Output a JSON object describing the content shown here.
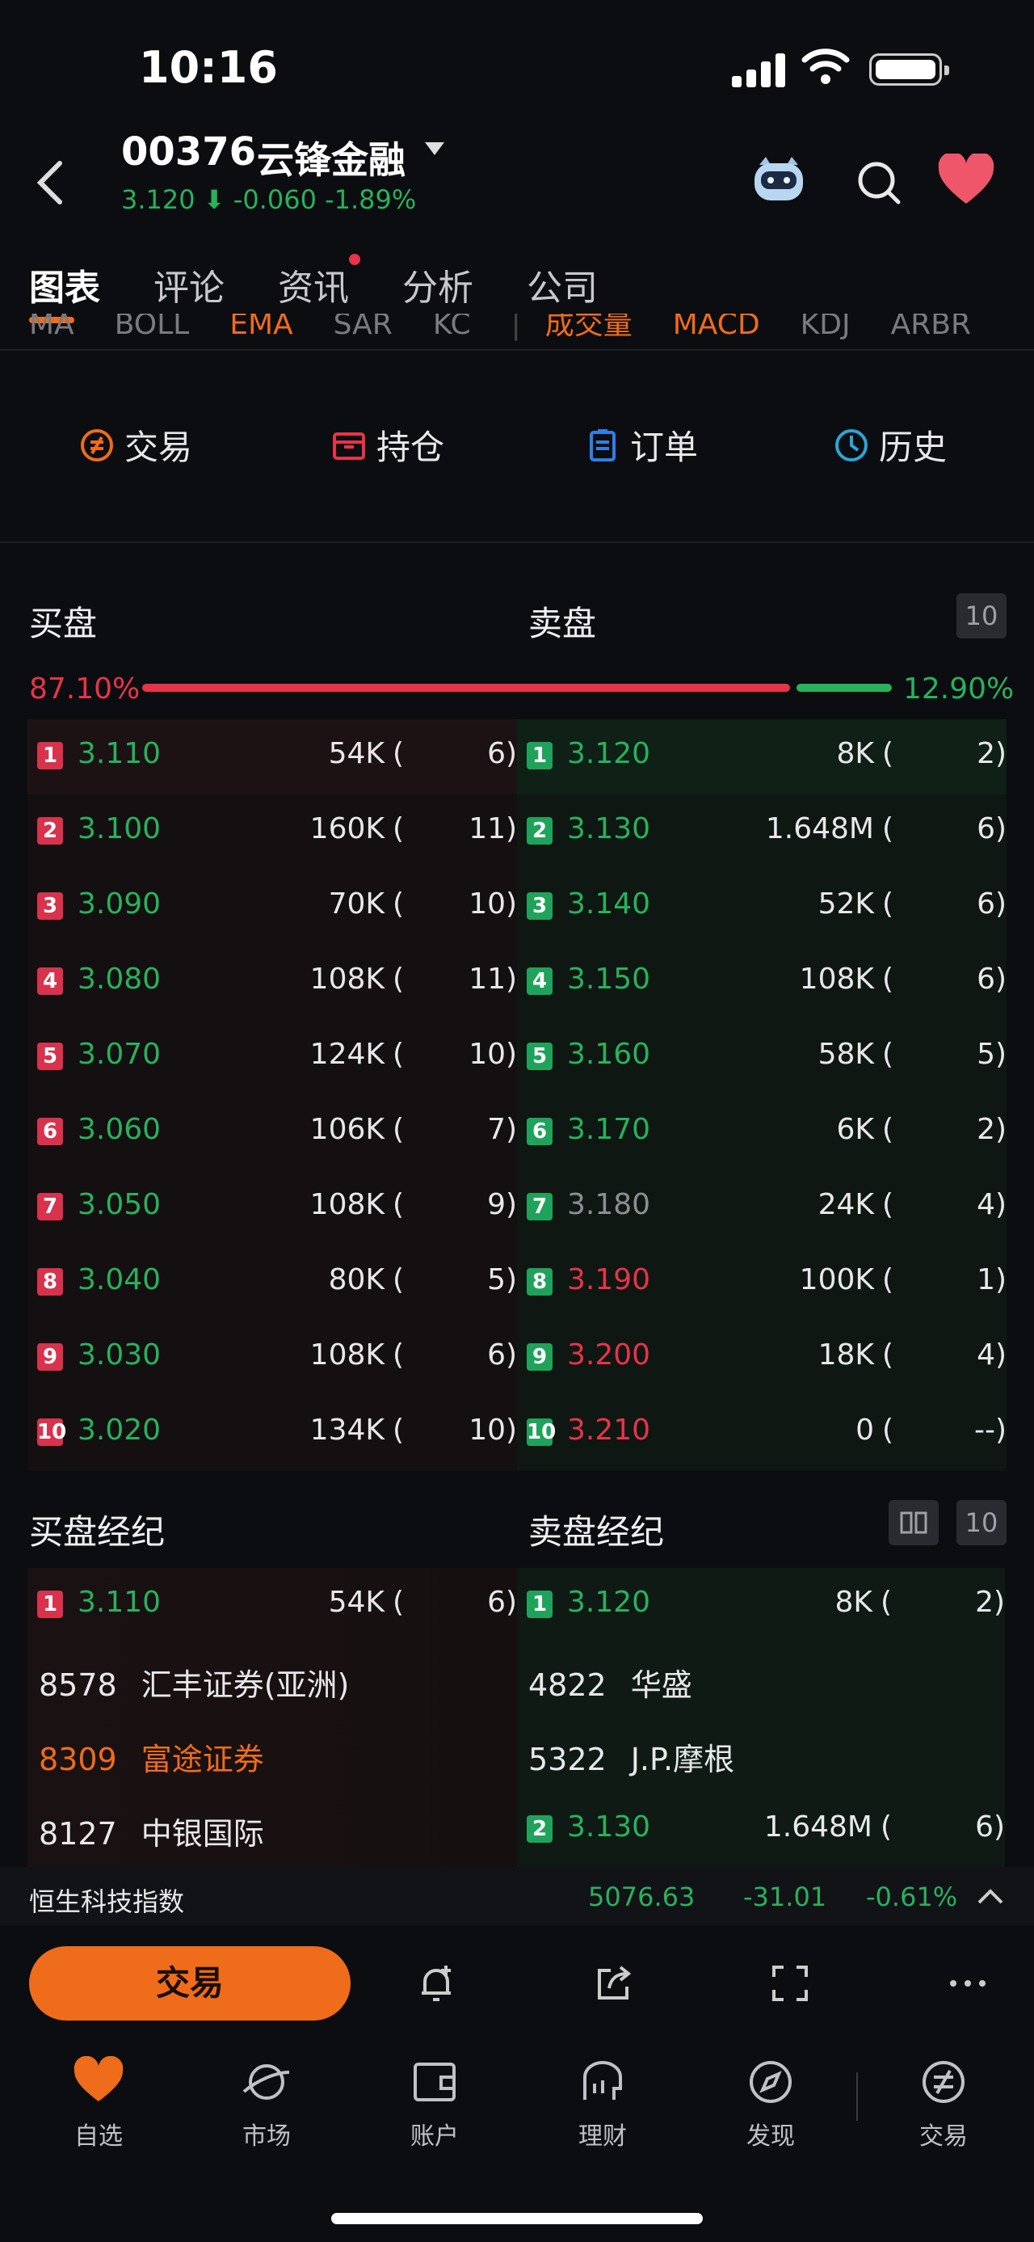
{
  "status": {
    "time": "10:16"
  },
  "header": {
    "code": "00376",
    "name": "云锋金融",
    "price": "3.120",
    "change": "-0.060",
    "change_pct": "-1.89%"
  },
  "tabs": [
    {
      "label": "图表",
      "active": true
    },
    {
      "label": "评论"
    },
    {
      "label": "资讯",
      "dot": true
    },
    {
      "label": "分析"
    },
    {
      "label": "公司"
    }
  ],
  "indicators": [
    "MA",
    "BOLL",
    "EMA",
    "SAR",
    "KC",
    "成交量",
    "MACD",
    "KDJ",
    "ARBR"
  ],
  "actions": [
    "交易",
    "持仓",
    "订单",
    "历史"
  ],
  "orderbook": {
    "bid_title": "买盘",
    "ask_title": "卖盘",
    "depth": "10",
    "bid_pct": "87.10%",
    "ask_pct": "12.90%",
    "bid_ratio": 0.871,
    "bids": [
      {
        "n": "1",
        "price": "3.110",
        "vol": "54K",
        "cnt": "6"
      },
      {
        "n": "2",
        "price": "3.100",
        "vol": "160K",
        "cnt": "11"
      },
      {
        "n": "3",
        "price": "3.090",
        "vol": "70K",
        "cnt": "10"
      },
      {
        "n": "4",
        "price": "3.080",
        "vol": "108K",
        "cnt": "11"
      },
      {
        "n": "5",
        "price": "3.070",
        "vol": "124K",
        "cnt": "10"
      },
      {
        "n": "6",
        "price": "3.060",
        "vol": "106K",
        "cnt": "7"
      },
      {
        "n": "7",
        "price": "3.050",
        "vol": "108K",
        "cnt": "9"
      },
      {
        "n": "8",
        "price": "3.040",
        "vol": "80K",
        "cnt": "5"
      },
      {
        "n": "9",
        "price": "3.030",
        "vol": "108K",
        "cnt": "6"
      },
      {
        "n": "10",
        "price": "3.020",
        "vol": "134K",
        "cnt": "10"
      }
    ],
    "asks": [
      {
        "n": "1",
        "price": "3.120",
        "vol": "8K",
        "cnt": "2",
        "c": "g"
      },
      {
        "n": "2",
        "price": "3.130",
        "vol": "1.648M",
        "cnt": "6",
        "c": "g"
      },
      {
        "n": "3",
        "price": "3.140",
        "vol": "52K",
        "cnt": "6",
        "c": "g"
      },
      {
        "n": "4",
        "price": "3.150",
        "vol": "108K",
        "cnt": "6",
        "c": "g"
      },
      {
        "n": "5",
        "price": "3.160",
        "vol": "58K",
        "cnt": "5",
        "c": "g"
      },
      {
        "n": "6",
        "price": "3.170",
        "vol": "6K",
        "cnt": "2",
        "c": "g"
      },
      {
        "n": "7",
        "price": "3.180",
        "vol": "24K",
        "cnt": "4",
        "c": "gr"
      },
      {
        "n": "8",
        "price": "3.190",
        "vol": "100K",
        "cnt": "1",
        "c": "r"
      },
      {
        "n": "9",
        "price": "3.200",
        "vol": "18K",
        "cnt": "4",
        "c": "r"
      },
      {
        "n": "10",
        "price": "3.210",
        "vol": "0",
        "cnt": "--",
        "c": "r"
      }
    ]
  },
  "brokers": {
    "bid_title": "买盘经纪",
    "ask_title": "卖盘经纪",
    "depth": "10",
    "bid_top": {
      "n": "1",
      "price": "3.110",
      "vol": "54K",
      "cnt": "6"
    },
    "ask_top": {
      "n": "1",
      "price": "3.120",
      "vol": "8K",
      "cnt": "2"
    },
    "bid_list": [
      {
        "id": "8578",
        "name": "汇丰证券(亚洲)"
      },
      {
        "id": "8309",
        "name": "富途证券",
        "highlight": true
      },
      {
        "id": "8127",
        "name": "中银国际"
      }
    ],
    "ask_list": [
      {
        "id": "4822",
        "name": "华盛"
      },
      {
        "id": "5322",
        "name": "J.P.摩根"
      }
    ],
    "ask_level2": {
      "n": "2",
      "price": "3.130",
      "vol": "1.648M",
      "cnt": "6"
    }
  },
  "index_bar": {
    "name": "恒生科技指数",
    "value": "5076.63",
    "change": "-31.01",
    "pct": "-0.61%"
  },
  "toolbar": {
    "trade_label": "交易"
  },
  "nav": [
    {
      "label": "自选",
      "active": true
    },
    {
      "label": "市场"
    },
    {
      "label": "账户"
    },
    {
      "label": "理财"
    },
    {
      "label": "发现"
    },
    {
      "label": "交易"
    }
  ],
  "colors": {
    "accent": "#ef6c1a",
    "up": "#27b25d",
    "down": "#e8334a"
  }
}
